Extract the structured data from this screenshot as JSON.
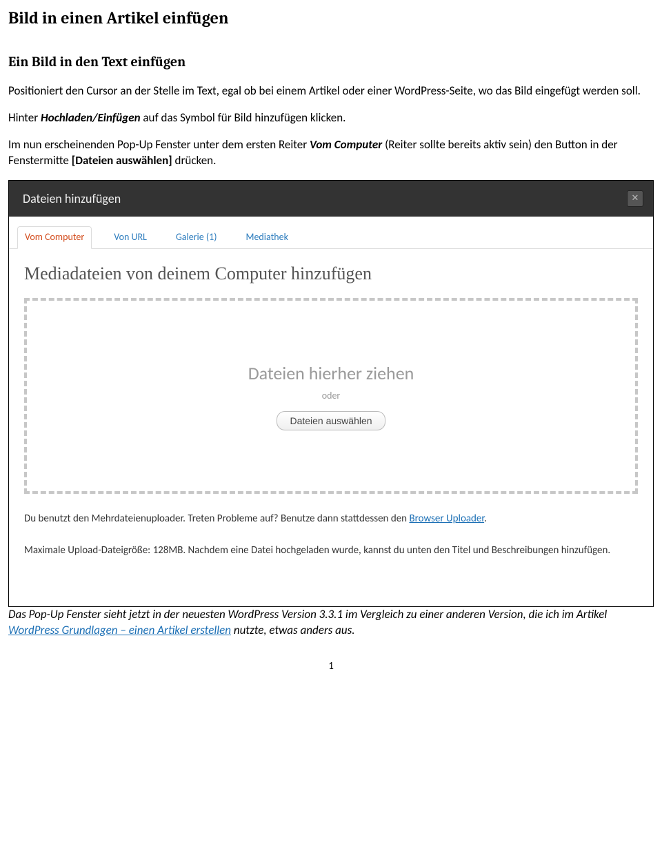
{
  "doc": {
    "title": "Bild in einen Artikel einfügen",
    "sectionTitle": "Ein Bild in den Text einfügen",
    "p1": "Positioniert den Cursor an der Stelle im Text, egal ob bei einem Artikel oder einer WordPress-Seite, wo das Bild eingefügt werden soll.",
    "p2a": "Hinter ",
    "p2b": "Hochladen/Einfügen",
    "p2c": " auf das Symbol für Bild hinzufügen klicken.",
    "p3a": "Im nun erscheinenden Pop-Up Fenster unter dem ersten Reiter ",
    "p3b": "Vom Computer",
    "p3c": " (Reiter sollte bereits aktiv sein) den Button in der Fenstermitte ",
    "p3d": "[Dateien auswählen]",
    "p3e": " drücken.",
    "cap1": "Das Pop-Up Fenster sieht jetzt in der neuesten WordPress Version 3.3.1 im Vergleich zu einer anderen Version, die ich im Artikel ",
    "capLink": "WordPress Grundlagen – einen Artikel erstellen",
    "cap2": " nutzte, etwas anders aus.",
    "pageNumber": "1"
  },
  "modal": {
    "title": "Dateien hinzufügen",
    "tabs": {
      "t0": "Vom Computer",
      "t1": "Von URL",
      "t2": "Galerie (1)",
      "t3": "Mediathek"
    },
    "heading": "Mediadateien von deinem Computer hinzufügen",
    "drop": {
      "main": "Dateien hierher ziehen",
      "or": "oder",
      "btn": "Dateien auswählen"
    },
    "info1a": "Du benutzt den Mehrdateienuploader. Treten Probleme auf? Benutze dann stattdessen den ",
    "info1Link": "Browser Uploader",
    "info1b": ".",
    "info2": "Maximale Upload-Dateigröße: 128MB. Nachdem eine Datei hochgeladen wurde, kannst du unten den Titel und Beschreibungen hinzufügen."
  }
}
